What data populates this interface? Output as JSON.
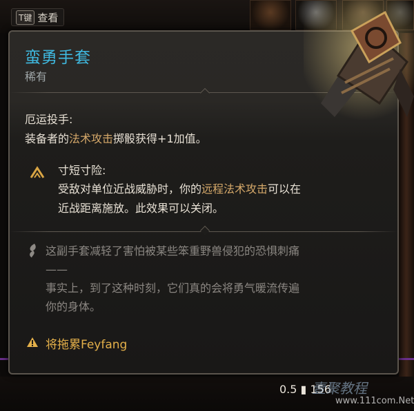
{
  "hint": {
    "key": "T键",
    "label": "查看"
  },
  "item": {
    "name": "蛮勇手套",
    "rarity": "稀有",
    "property": {
      "title": "厄运投手:",
      "desc_pre": "装备者的",
      "desc_hl": "法术攻击",
      "desc_post": "掷骰获得+1加值。"
    },
    "toggle": {
      "title": "寸短寸险:",
      "line1_pre": "受敌对单位近战威胁时，你的",
      "line1_hl": "远程法术攻击",
      "line1_post": "可以在",
      "line2": "近战距离施放。此效果可以关闭。"
    },
    "lore": [
      "这副手套减轻了害怕被某些笨重野兽侵犯的恐惧刺痛",
      "——",
      "事实上，到了这种时刻，它们真的会将勇气暖流传遍",
      "你的身体。"
    ],
    "warning": "将拖累Feyfang"
  },
  "stats": {
    "weight": "0.5",
    "value": "156"
  },
  "watermark": {
    "title": "壹聚教程",
    "url": "www.111com.Net"
  },
  "colors": {
    "title": "#3fb9e0",
    "highlight": "#d6a96a",
    "warning": "#e4b04a"
  }
}
